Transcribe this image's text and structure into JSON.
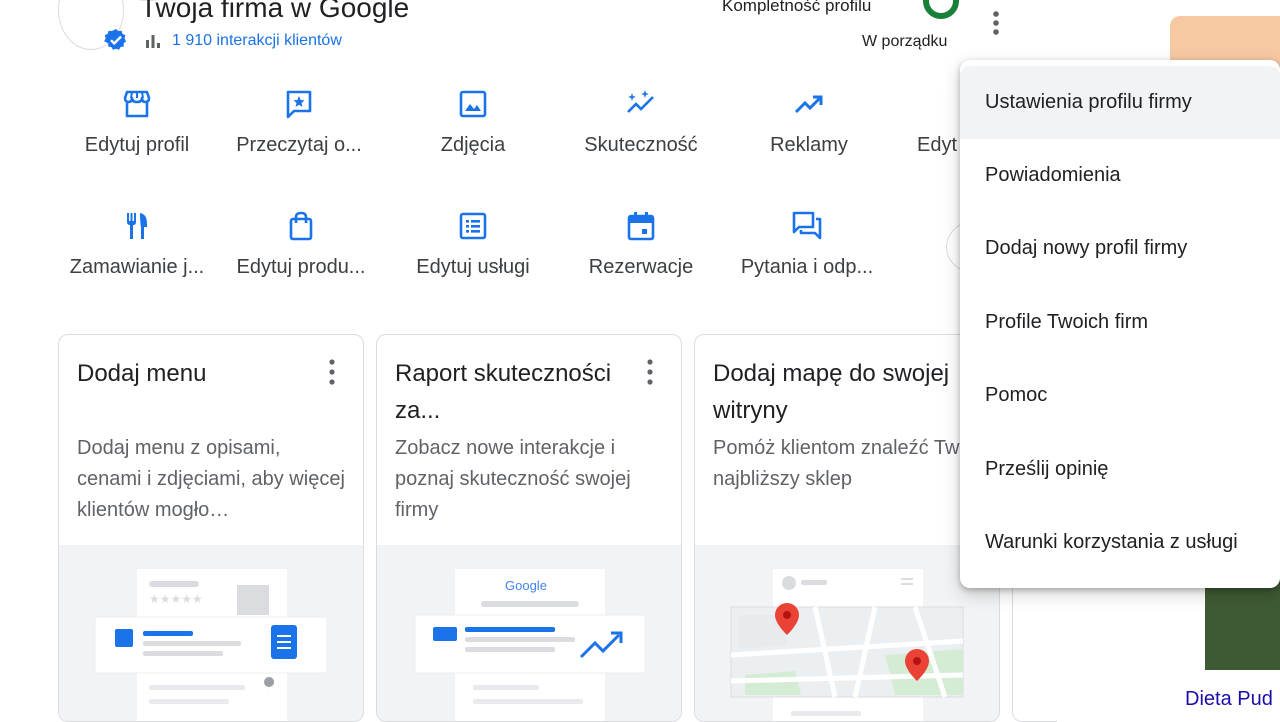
{
  "header": {
    "title": "Twoja firma w Google",
    "interactions": "1 910 interakcji klientów",
    "completeness_label": "Kompletność profilu",
    "completeness_status": "W porządku"
  },
  "actions": [
    {
      "label": "Edytuj profil",
      "icon": "storefront-icon"
    },
    {
      "label": "Przeczytaj o...",
      "icon": "review-star-icon"
    },
    {
      "label": "Zdjęcia",
      "icon": "photo-icon"
    },
    {
      "label": "Skuteczność",
      "icon": "performance-sparkle-icon"
    },
    {
      "label": "Reklamy",
      "icon": "trending-up-icon"
    },
    {
      "label": "Edyt",
      "icon": "edit-icon"
    },
    {
      "label": "Zamawianie j...",
      "icon": "restaurant-icon"
    },
    {
      "label": "Edytuj produ...",
      "icon": "shopping-bag-icon"
    },
    {
      "label": "Edytuj usługi",
      "icon": "list-icon"
    },
    {
      "label": "Rezerwacje",
      "icon": "calendar-icon"
    },
    {
      "label": "Pytania i odp...",
      "icon": "forum-icon"
    }
  ],
  "cards": [
    {
      "title": "Dodaj menu",
      "desc": "Dodaj menu z opisami, cenami i zdjęciami, aby więcej klientów mogło…"
    },
    {
      "title": "Raport skuteczności za...",
      "desc": "Zobacz nowe interakcje i poznaj skuteczność swojej firmy",
      "logo": "Google"
    },
    {
      "title": "Dodaj mapę do swojej witryny",
      "desc": "Pomóż klientom znaleźć Twój najbliższy sklep"
    }
  ],
  "menu": {
    "items": [
      "Ustawienia profilu firmy",
      "Powiadomienia",
      "Dodaj nowy profil firmy",
      "Profile Twoich firm",
      "Pomoc",
      "Prześlij opinię",
      "Warunki korzystania z usługi"
    ]
  },
  "side_product": {
    "name": "Dieta Pud"
  },
  "colors": {
    "accent": "#1a73e8",
    "ring": "#188038",
    "text": "#202124",
    "muted": "#5f6368"
  }
}
